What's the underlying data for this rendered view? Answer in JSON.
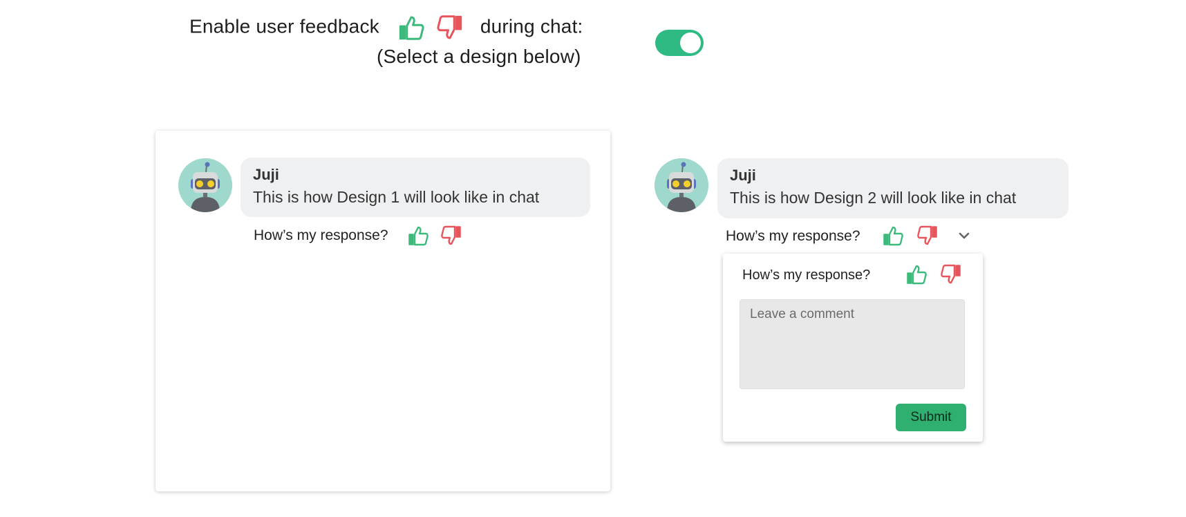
{
  "header": {
    "line1_before": "Enable user feedback",
    "line1_after": "during chat:",
    "line2": "(Select a design below)",
    "toggle_on": true
  },
  "colors": {
    "accent": "#2fb983",
    "thumbs_up": "#3dba7b",
    "thumbs_down": "#e8545c",
    "bubble": "#eff0f2",
    "submit": "#2fb070"
  },
  "icons": [
    "thumbs-up-icon",
    "thumbs-down-icon",
    "robot-icon",
    "chevron-down-icon"
  ],
  "design1": {
    "bot_name": "Juji",
    "message": "This is how Design 1 will look like in chat",
    "feedback_prompt": "How’s my response?"
  },
  "design2": {
    "bot_name": "Juji",
    "message": "This is how Design 2 will look like in chat",
    "feedback_prompt": "How’s my response?",
    "popup": {
      "prompt": "How’s my response?",
      "comment_placeholder": "Leave a comment",
      "submit_label": "Submit"
    }
  }
}
